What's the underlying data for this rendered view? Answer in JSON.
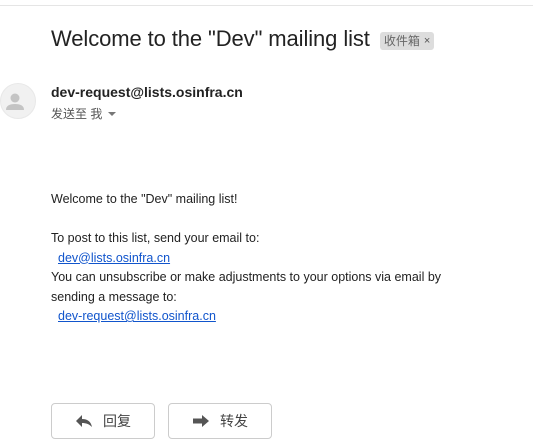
{
  "email": {
    "subject": "Welcome to the \"Dev\" mailing list",
    "label": "收件箱",
    "label_close": "×",
    "sender": "dev-request@lists.osinfra.cn",
    "recipient_text": "发送至 我"
  },
  "body": {
    "line1": "Welcome to the \"Dev\" mailing list!",
    "line2": "To post to this list, send your email to:",
    "post_address": "dev@lists.osinfra.cn",
    "line3": "You can unsubscribe or make adjustments to your options via email by",
    "line4": "sending a message to:",
    "request_address": "dev-request@lists.osinfra.cn"
  },
  "actions": {
    "reply_label": "回复",
    "forward_label": "转发"
  },
  "icons": {
    "avatar": "person-icon",
    "reply": "reply-arrow-icon",
    "forward": "forward-arrow-icon",
    "dropdown": "caret-down-icon"
  },
  "colors": {
    "link": "#1155cc",
    "chip_bg": "#dddddd",
    "text": "#222222"
  }
}
